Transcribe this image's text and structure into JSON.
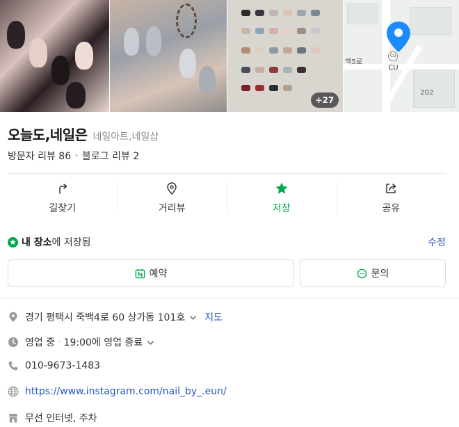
{
  "gallery": {
    "more_count": "+27"
  },
  "map": {
    "store_label": "CU",
    "badge_text": "CU",
    "road_label": "백5로",
    "block_number": "202"
  },
  "place": {
    "name": "오늘도,네일은",
    "category": "네일아트,네일샵"
  },
  "reviews": {
    "visitor": "방문자 리뷰 86",
    "blog": "블로그 리뷰 2"
  },
  "actions": [
    {
      "label": "길찾기",
      "icon": "directions-icon"
    },
    {
      "label": "거리뷰",
      "icon": "street-view-icon"
    },
    {
      "label": "저장",
      "icon": "star-icon",
      "active": true
    },
    {
      "label": "공유",
      "icon": "share-icon"
    }
  ],
  "saved": {
    "strong": "내 장소",
    "rest": "에 저장됨",
    "edit": "수정"
  },
  "buttons": {
    "reserve": "예약",
    "inquiry": "문의"
  },
  "info": {
    "address": "경기 평택시 죽백4로 60 상가동 101호",
    "map_link": "지도",
    "status": "영업 중",
    "hours": "19:00에 영업 종료",
    "phone": "010-9673-1483",
    "website": "https://www.instagram.com/nail_by_.eun/",
    "amenities": "무선 인터넷, 주차"
  },
  "colors": {
    "accent_green": "#03a94d",
    "link_blue": "#2557c4",
    "pin_blue": "#1a8cff"
  }
}
